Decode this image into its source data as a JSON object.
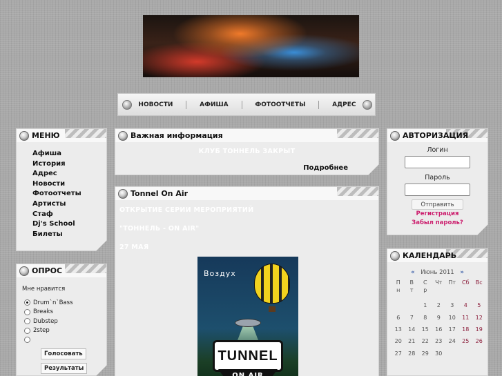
{
  "nav": {
    "items": [
      "НОВОСТИ",
      "АФИША",
      "ФОТООТЧЕТЫ",
      "АДРЕС"
    ]
  },
  "menu": {
    "title": "МЕНЮ",
    "items": [
      "Афиша",
      "История",
      "Адрес",
      "Новости",
      "Фотоотчеты",
      "Артисты",
      "Стаф",
      "Dj's School",
      "Билеты"
    ]
  },
  "poll": {
    "title": "ОПРОС",
    "question": "Мне нравится",
    "options": [
      "Drum`n`Bass",
      "Breaks",
      "Dubstep",
      "2step",
      ""
    ],
    "selected_index": 0,
    "vote_label": "Голосовать",
    "results_label": "Результаты"
  },
  "info": {
    "title": "Важная информация",
    "text": "КЛУБ ТОННЕЛЬ ЗАКРЫТ",
    "more_label": "Подробнее"
  },
  "tunnel": {
    "title": "Tonnel On Air",
    "lines": [
      "ОТКРЫТИЕ СЕРИИ МЕРОПРИЯТИЙ",
      "\"ТОННЕЛЬ - ON AIR\"",
      "27 МАЯ"
    ],
    "poster": {
      "top_word": "Воздух",
      "logo": "TUNNEL",
      "badge": "ON AIR"
    }
  },
  "auth": {
    "title": "АВТОРИЗАЦИЯ",
    "login_label": "Логин",
    "password_label": "Пароль",
    "submit_label": "Отправить",
    "register_label": "Регистрация",
    "forgot_label": "Забыл пароль?"
  },
  "calendar": {
    "title": "КАЛЕНДАРЬ",
    "prev": "«",
    "next": "»",
    "month": "Июнь 2011",
    "weekdays": [
      "П\nн",
      "В\nт",
      "С\nр",
      "Чт",
      "Пт",
      "Сб",
      "Вс"
    ],
    "weeks": [
      [
        "",
        "",
        "1",
        "2",
        "3",
        "4",
        "5"
      ],
      [
        "6",
        "7",
        "8",
        "9",
        "10",
        "11",
        "12"
      ],
      [
        "13",
        "14",
        "15",
        "16",
        "17",
        "18",
        "19"
      ],
      [
        "20",
        "21",
        "22",
        "23",
        "24",
        "25",
        "26"
      ],
      [
        "27",
        "28",
        "29",
        "30",
        "",
        "",
        ""
      ]
    ],
    "weekend_color": "#8b1d3a"
  }
}
